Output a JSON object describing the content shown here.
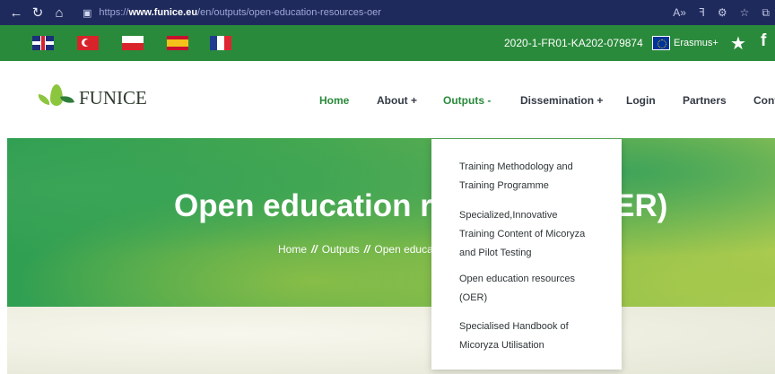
{
  "browser": {
    "url_prefix": "https://",
    "url_domain": "www.funice.eu",
    "url_path": "/en/outputs/open-education-resources-oer",
    "icons": [
      "back-icon",
      "refresh-icon",
      "home-icon",
      "lock-icon",
      "read-aloud-icon",
      "translate-icon",
      "extensions-icon",
      "favorites-icon",
      "collections-icon"
    ]
  },
  "topbar": {
    "languages": [
      "English",
      "Turkish",
      "Polish",
      "Spanish",
      "French"
    ],
    "project_code": "2020-1-FR01-KA202-079874",
    "erasmus_label": "Erasmus+"
  },
  "header": {
    "logo_text": "FUNICE",
    "nav": {
      "home": "Home",
      "about": "About +",
      "outputs": "Outputs -",
      "dissemination": "Dissemination +",
      "login": "Login",
      "partners": "Partners",
      "contact": "Cont"
    }
  },
  "hero": {
    "title": "Open education resources (OER)",
    "breadcrumb": {
      "home": "Home",
      "sep1": "//",
      "outputs": "Outputs",
      "sep2": "//",
      "current": "Open education resources (OER)"
    }
  },
  "dropdown": {
    "items": [
      {
        "line1": "Training Methodology and",
        "line2": "Training Programme",
        "line3": ""
      },
      {
        "line1": "Specialized,Innovative",
        "line2": "Training Content of Micoryza",
        "line3": "and Pilot Testing"
      },
      {
        "line1": "Open education resources",
        "line2": "(OER)",
        "line3": ""
      },
      {
        "line1": "Specialised Handbook of",
        "line2": "Micoryza Utilisation",
        "line3": ""
      }
    ]
  },
  "colors": {
    "browser_bar": "#1f2a5c",
    "brand_green": "#2a8a3b",
    "nav_text": "#333a44"
  }
}
